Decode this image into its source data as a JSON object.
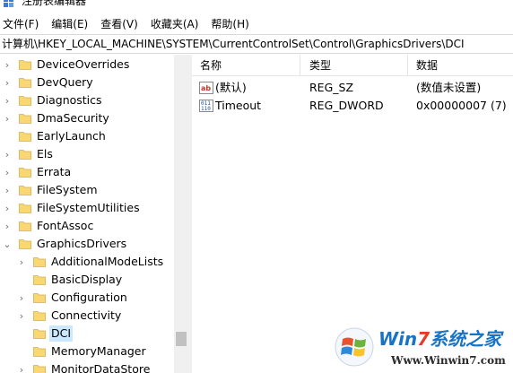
{
  "window": {
    "title": "注册表编辑器"
  },
  "menu": [
    "文件(F)",
    "编辑(E)",
    "查看(V)",
    "收藏夹(A)",
    "帮助(H)"
  ],
  "address": "计算机\\HKEY_LOCAL_MACHINE\\SYSTEM\\CurrentControlSet\\Control\\GraphicsDrivers\\DCI",
  "tree": [
    {
      "label": "DeviceOverrides",
      "expander": "›",
      "selected": false
    },
    {
      "label": "DevQuery",
      "expander": "›",
      "selected": false
    },
    {
      "label": "Diagnostics",
      "expander": "›",
      "selected": false
    },
    {
      "label": "DmaSecurity",
      "expander": "›",
      "selected": false
    },
    {
      "label": "EarlyLaunch",
      "expander": "",
      "selected": false
    },
    {
      "label": "Els",
      "expander": "›",
      "selected": false
    },
    {
      "label": "Errata",
      "expander": "›",
      "selected": false
    },
    {
      "label": "FileSystem",
      "expander": "›",
      "selected": false
    },
    {
      "label": "FileSystemUtilities",
      "expander": "›",
      "selected": false
    },
    {
      "label": "FontAssoc",
      "expander": "›",
      "selected": false
    },
    {
      "label": "GraphicsDrivers",
      "expander": "⌄",
      "selected": false
    },
    {
      "label": "AdditionalModeLists",
      "expander": "›",
      "selected": false
    },
    {
      "label": "BasicDisplay",
      "expander": "",
      "selected": false
    },
    {
      "label": "Configuration",
      "expander": "›",
      "selected": false
    },
    {
      "label": "Connectivity",
      "expander": "›",
      "selected": false
    },
    {
      "label": "DCI",
      "expander": "",
      "selected": true
    },
    {
      "label": "MemoryManager",
      "expander": "",
      "selected": false
    },
    {
      "label": "MonitorDataStore",
      "expander": "›",
      "selected": false
    }
  ],
  "columns": {
    "name": "名称",
    "type": "类型",
    "data": "数据"
  },
  "values": [
    {
      "icon": "string-value-icon",
      "name": "(默认)",
      "type": "REG_SZ",
      "data": "(数值未设置)"
    },
    {
      "icon": "binary-value-icon",
      "name": "Timeout",
      "type": "REG_DWORD",
      "data": "0x00000007 (7)"
    }
  ],
  "watermark": {
    "brand_a": "Win",
    "brand_b": "7",
    "brand_c": "系统之家",
    "url": "Www.Winwin7.com"
  },
  "colors": {
    "selection": "#cce8ff",
    "folder": "#f8d775",
    "brand_blue": "#1a73c2",
    "brand_red": "#e53b2c"
  }
}
